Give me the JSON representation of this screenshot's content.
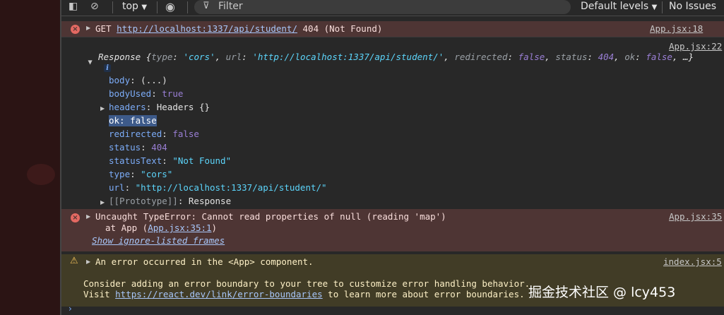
{
  "toolbar": {
    "context": "top",
    "filter_placeholder": "Filter",
    "levels": "Default levels",
    "issues": "No Issues",
    "icons": [
      "sidebar-toggle-icon",
      "clear-console-icon",
      "eye-icon",
      "filter-icon"
    ]
  },
  "messages": {
    "get404": {
      "method": "GET",
      "url": "http://localhost:1337/api/student/",
      "status": "404 (Not Found)",
      "source": "App.jsx:18"
    },
    "response": {
      "source": "App.jsx:22",
      "label": "Response",
      "summary_pre": " {",
      "summary_k1": "type",
      "summary_v1": "'cors'",
      "summary_k2": "url",
      "summary_v2": "'http://localhost:1337/api/student/'",
      "summary_k3": "redirected",
      "summary_v3": "false",
      "summary_k4": "status",
      "summary_v4": "404",
      "summary_k5": "ok",
      "summary_v5": "false",
      "summary_end": ", …}",
      "props": {
        "body_k": "body",
        "body_v": "(...)",
        "bodyUsed_k": "bodyUsed",
        "bodyUsed_v": "true",
        "headers_k": "headers",
        "headers_v": "Headers {}",
        "ok_line": "ok: false",
        "redirected_k": "redirected",
        "redirected_v": "false",
        "status_k": "status",
        "status_v": "404",
        "statusText_k": "statusText",
        "statusText_v": "\"Not Found\"",
        "type_k": "type",
        "type_v": "\"cors\"",
        "url_k": "url",
        "url_v": "\"http://localhost:1337/api/student/\"",
        "proto_k": "[[Prototype]]",
        "proto_v": "Response"
      }
    },
    "typeError": {
      "text": "Uncaught TypeError: Cannot read properties of null (reading 'map')",
      "at_prefix": "at App (",
      "at_link": "App.jsx:35:1",
      "at_suffix": ")",
      "ignore": "Show ignore-listed frames",
      "source": "App.jsx:35"
    },
    "warning": {
      "text": "An error occurred in the <App> component.",
      "line2": "Consider adding an error boundary to your tree to customize error handling behavior.",
      "visit": "Visit ",
      "link": "https://react.dev/link/error-boundaries",
      "tail": " to learn more about error boundaries.",
      "source": "index.jsx:5"
    }
  },
  "watermark": "掘金技术社区 @ lcy453",
  "prompt": "›"
}
